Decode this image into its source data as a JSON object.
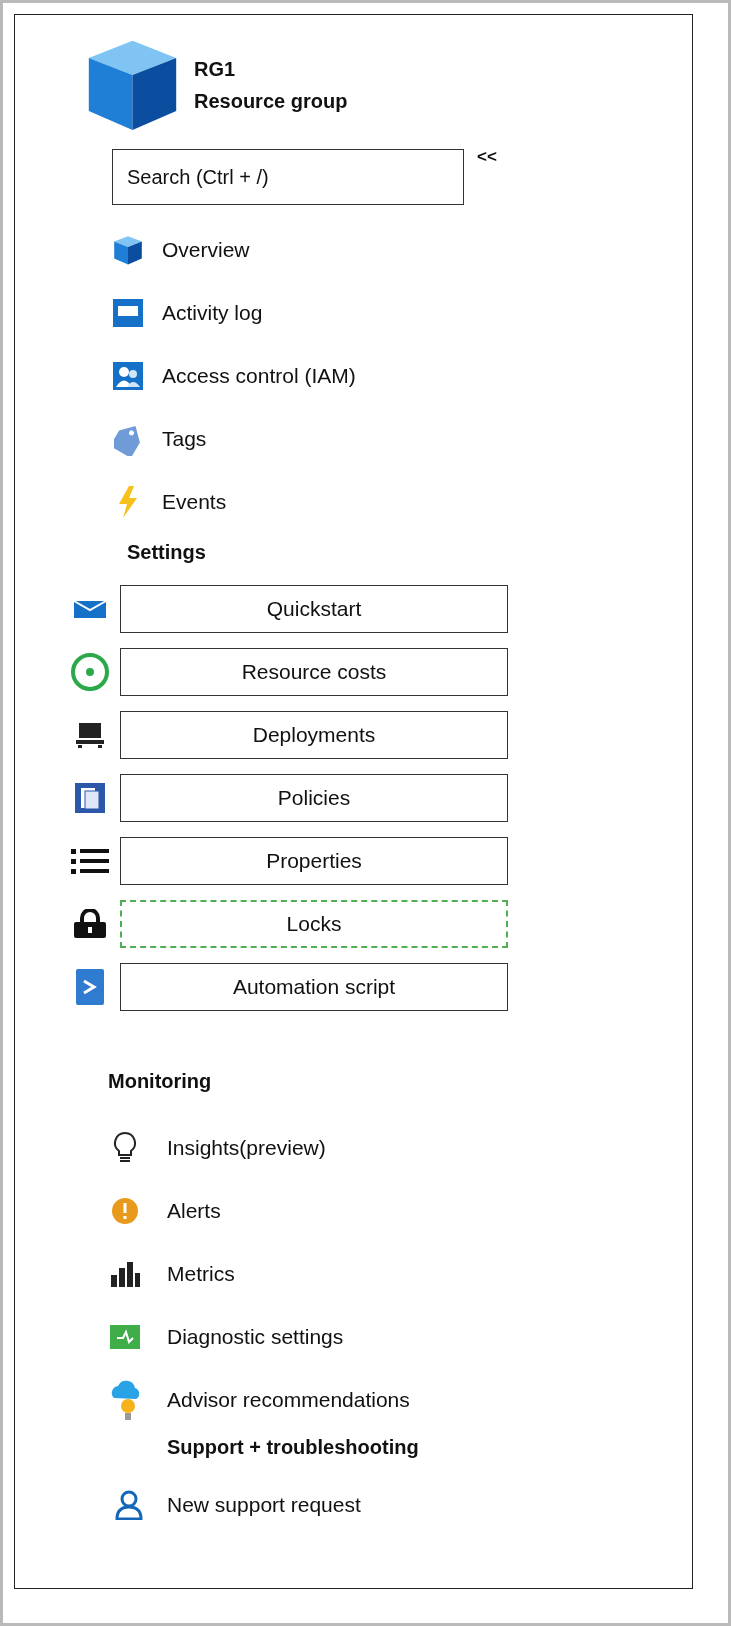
{
  "header": {
    "title": "RG1",
    "subtitle": "Resource group"
  },
  "search": {
    "placeholder": "Search (Ctrl + /)"
  },
  "collapse": "<<",
  "menu": [
    {
      "label": "Overview"
    },
    {
      "label": "Activity log"
    },
    {
      "label": "Access control (IAM)"
    },
    {
      "label": "Tags"
    },
    {
      "label": "Events"
    }
  ],
  "settings": {
    "heading": "Settings",
    "items": [
      {
        "label": "Quickstart",
        "highlighted": false
      },
      {
        "label": "Resource costs",
        "highlighted": false
      },
      {
        "label": "Deployments",
        "highlighted": false
      },
      {
        "label": "Policies",
        "highlighted": false
      },
      {
        "label": "Properties",
        "highlighted": false
      },
      {
        "label": "Locks",
        "highlighted": true
      },
      {
        "label": "Automation script",
        "highlighted": false
      }
    ]
  },
  "monitoring": {
    "heading": "Monitoring",
    "items": [
      {
        "label": "Insights(preview)"
      },
      {
        "label": "Alerts"
      },
      {
        "label": "Metrics"
      },
      {
        "label": "Diagnostic settings"
      },
      {
        "label": "Advisor recommendations"
      }
    ]
  },
  "support": {
    "heading": "Support + troubleshooting",
    "items": [
      {
        "label": "New support request"
      }
    ]
  }
}
